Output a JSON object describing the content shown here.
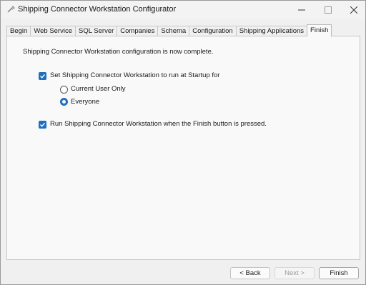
{
  "window": {
    "title": "Shipping Connector Workstation Configurator"
  },
  "tabs": [
    {
      "label": "Begin"
    },
    {
      "label": "Web Service"
    },
    {
      "label": "SQL Server"
    },
    {
      "label": "Companies"
    },
    {
      "label": "Schema"
    },
    {
      "label": "Configuration"
    },
    {
      "label": "Shipping Applications"
    },
    {
      "label": "Finish"
    }
  ],
  "active_tab": "Finish",
  "finish": {
    "complete_message": "Shipping Connector Workstation configuration is now complete.",
    "startup_checkbox": {
      "label": "Set Shipping Connector Workstation to run at Startup for",
      "checked": true
    },
    "radio_current_user": {
      "label": "Current User Only",
      "selected": false
    },
    "radio_everyone": {
      "label": "Everyone",
      "selected": true
    },
    "run_checkbox": {
      "label": "Run Shipping Connector Workstation when the Finish button is pressed.",
      "checked": true
    }
  },
  "buttons": {
    "back": "< Back",
    "next": "Next >",
    "finish": "Finish"
  },
  "colors": {
    "accent": "#1f6fbf",
    "panel": "#f9f9f9",
    "window": "#f0f0f0"
  }
}
